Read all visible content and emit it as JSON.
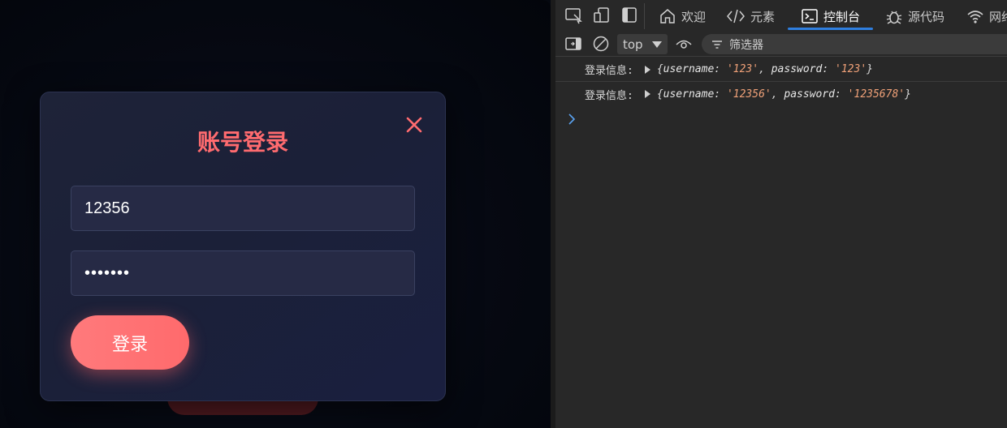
{
  "modal": {
    "title": "账号登录",
    "username_value": "12356",
    "password_value": "1235678",
    "login_label": "登录"
  },
  "devtools": {
    "tabs": [
      {
        "label": "欢迎",
        "icon": "home-icon"
      },
      {
        "label": "元素",
        "icon": "code-icon"
      },
      {
        "label": "控制台",
        "icon": "console-icon",
        "active": true
      },
      {
        "label": "源代码",
        "icon": "bug-icon"
      },
      {
        "label": "网络",
        "icon": "wifi-icon"
      }
    ],
    "context": "top",
    "filter_placeholder": "筛选器",
    "logs": [
      {
        "prefix": "登录信息:",
        "key_username": "username",
        "username": "'123'",
        "key_password": "password",
        "password": "'123'"
      },
      {
        "prefix": "登录信息:",
        "key_username": "username",
        "username": "'12356'",
        "key_password": "password",
        "password": "'1235678'"
      }
    ]
  },
  "colors": {
    "accent": "#ff6b6f",
    "devtools_active_tab": "#2f7fe0",
    "string_value": "#f0a178"
  }
}
